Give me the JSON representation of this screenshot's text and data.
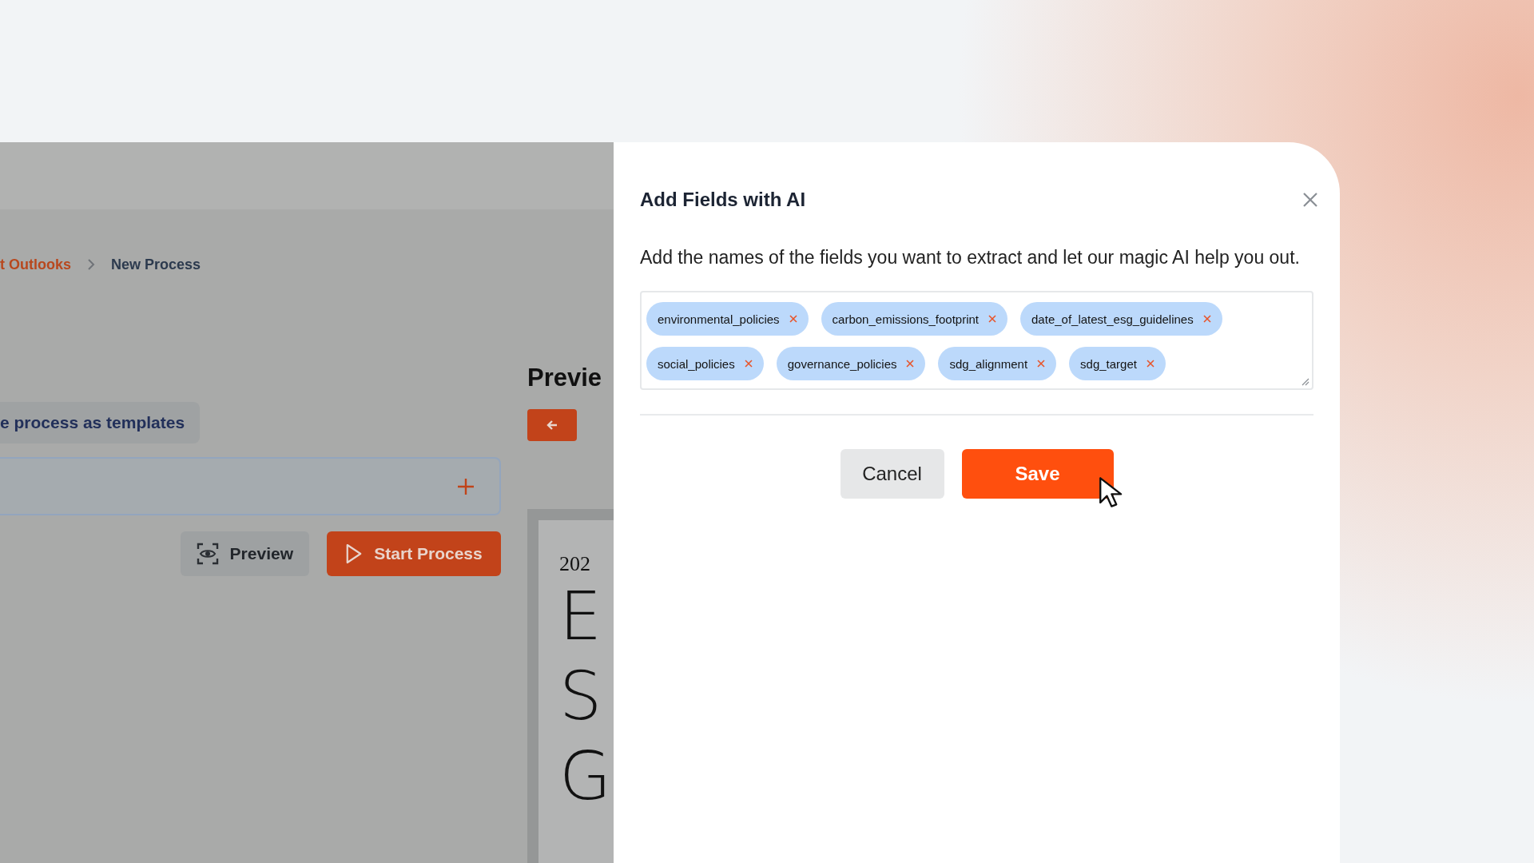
{
  "background_app": {
    "breadcrumb": [
      {
        "label": "t Outlooks",
        "current": false
      },
      {
        "label": "New Process",
        "current": true
      }
    ],
    "template_chip": "e process as templates",
    "actions": [
      {
        "kind": "preview",
        "label": "Preview"
      },
      {
        "kind": "start",
        "label": "Start Process"
      }
    ],
    "preview_panel": {
      "title": "Previe",
      "document": {
        "year": "202",
        "letters": [
          "E",
          "S",
          "G"
        ]
      }
    }
  },
  "dialog": {
    "title": "Add Fields with AI",
    "description": "Add the names of the fields you want to extract and let our magic AI help you out.",
    "tags": [
      "environmental_policies",
      "carbon_emissions_footprint",
      "date_of_latest_esg_guidelines",
      "social_policies",
      "governance_policies",
      "sdg_alignment",
      "sdg_target"
    ],
    "buttons": [
      {
        "kind": "secondary",
        "label": "Cancel"
      },
      {
        "kind": "primary",
        "label": "Save"
      }
    ]
  }
}
